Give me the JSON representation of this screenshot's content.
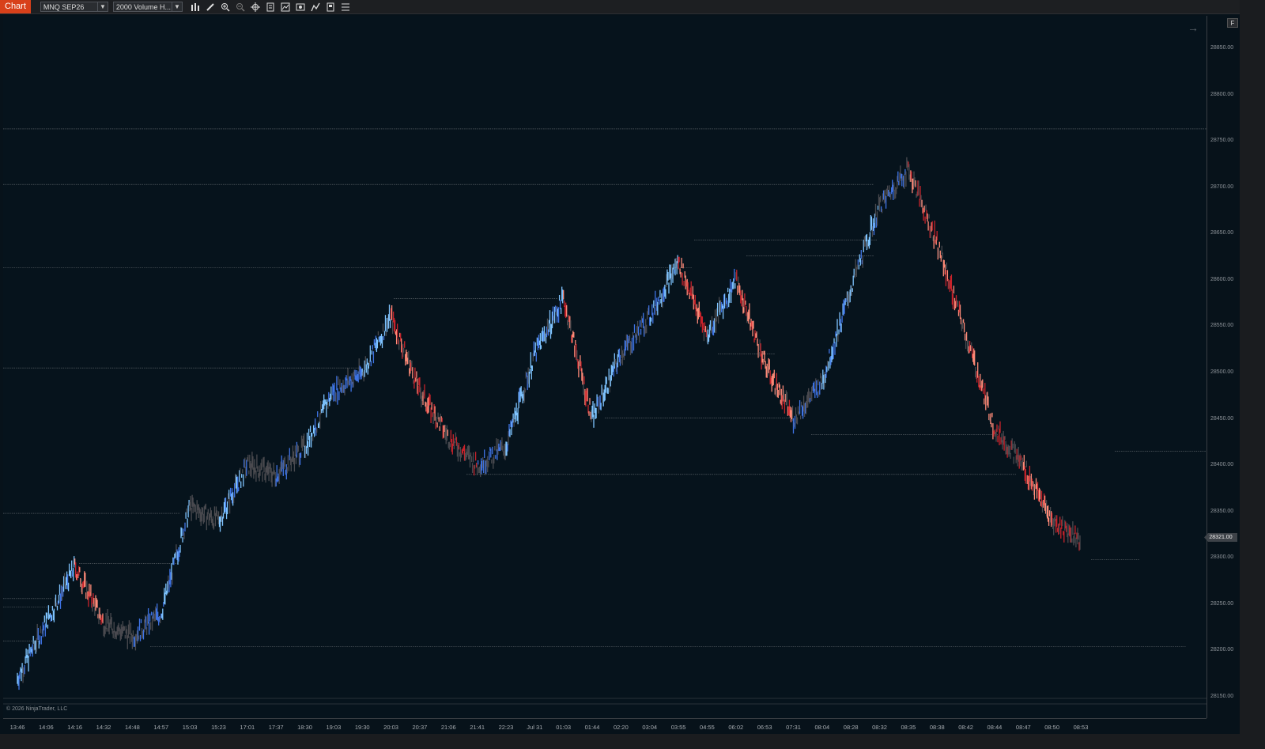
{
  "toolbar": {
    "tab_label": "Chart",
    "instrument": "MNQ SEP26",
    "bar_type": "2000 Volume H...",
    "tools": [
      "bars-icon",
      "pencil-icon",
      "zoom-in-icon",
      "zoom-out-icon",
      "crosshair-icon",
      "template-icon",
      "indicator-icon",
      "screenshot-icon",
      "strategy-icon",
      "data-box-icon",
      "properties-icon"
    ]
  },
  "chart": {
    "copyright": "© 2026 NinjaTrader, LLC",
    "f_button": "F",
    "current_price": "28321.00",
    "price_labels": [
      "28850.00",
      "28800.00",
      "28750.00",
      "28700.00",
      "28650.00",
      "28600.00",
      "28550.00",
      "28500.00",
      "28450.00",
      "28400.00",
      "28350.00",
      "28300.00",
      "28250.00",
      "28200.00",
      "28150.00"
    ],
    "time_labels": [
      "13:46",
      "14:06",
      "14:16",
      "14:32",
      "14:48",
      "14:57",
      "15:03",
      "15:23",
      "17:01",
      "17:37",
      "18:30",
      "19:03",
      "19:30",
      "20:03",
      "20:37",
      "21:06",
      "21:41",
      "22:23",
      "Jul 31",
      "01:03",
      "01:44",
      "02:20",
      "03:04",
      "03:55",
      "04:55",
      "06:02",
      "06:53",
      "07:31",
      "08:04",
      "08:28",
      "08:32",
      "08:35",
      "08:38",
      "08:42",
      "08:44",
      "08:47",
      "08:50",
      "08:53"
    ],
    "colors": {
      "background": "#06131c",
      "neutral_bar": "#4a4a4f",
      "up_light": "#7fc4ff",
      "up_strong": "#3f74e6",
      "down_strong": "#c8232b",
      "down_light": "#ff8b78",
      "level_line": "#6b7176"
    }
  },
  "chart_data": {
    "type": "line",
    "xlabel": "",
    "ylabel": "",
    "ylim": [
      28130,
      28880
    ],
    "x": [
      "13:46",
      "14:06",
      "14:16",
      "14:32",
      "14:48",
      "14:57",
      "15:03",
      "15:23",
      "17:01",
      "17:37",
      "18:30",
      "19:03",
      "19:30",
      "20:03",
      "20:37",
      "21:06",
      "21:41",
      "22:23",
      "Jul 31",
      "01:03",
      "01:44",
      "02:20",
      "03:04",
      "03:55",
      "04:55",
      "06:02",
      "06:53",
      "07:31",
      "08:04",
      "08:28",
      "08:32",
      "08:35",
      "08:38",
      "08:42",
      "08:44",
      "08:47",
      "08:50",
      "08:53"
    ],
    "series": [
      {
        "values": [
          28170,
          28230,
          28290,
          28230,
          28215,
          28240,
          28355,
          28340,
          28400,
          28390,
          28420,
          28480,
          28500,
          28560,
          28480,
          28430,
          28400,
          28420,
          28520,
          28580,
          28450,
          28520,
          28560,
          28620,
          28540,
          28600,
          28510,
          28450,
          28490,
          28590,
          28680,
          28720,
          28640,
          28540,
          28440,
          28400,
          28340,
          28320
        ]
      }
    ],
    "levels": [
      28763,
      28703,
      28613,
      28580,
      28505,
      28643,
      28626,
      28520,
      28451,
      28433,
      28390,
      28415,
      28348,
      28298,
      28256,
      28247,
      28210,
      28204,
      28294
    ]
  }
}
